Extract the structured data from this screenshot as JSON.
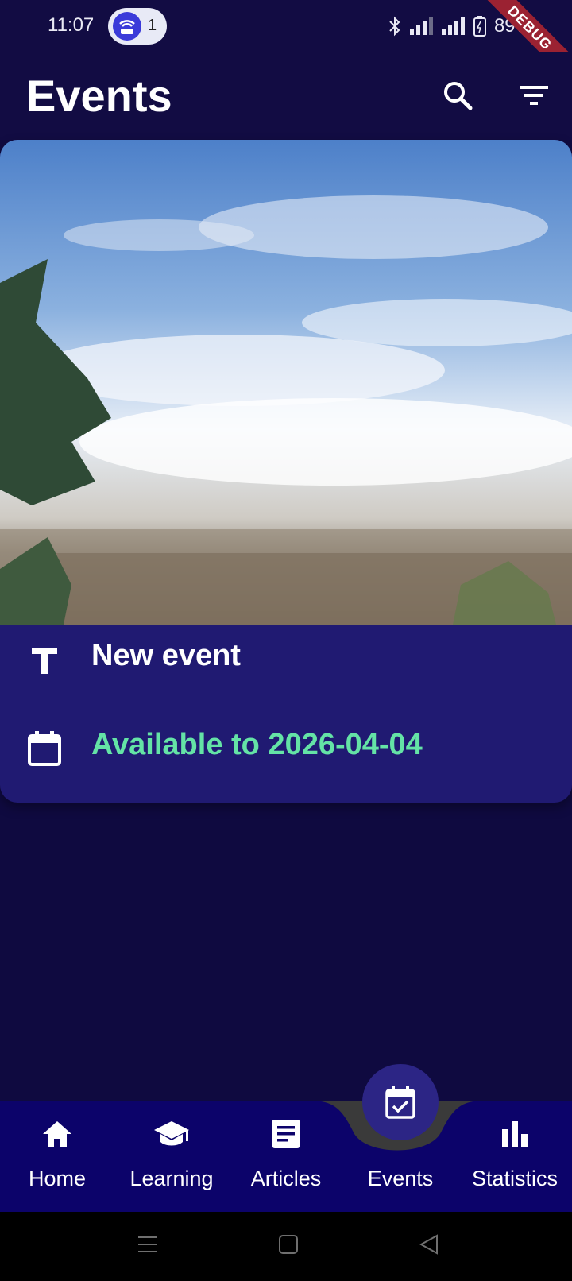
{
  "status_bar": {
    "time": "11:07",
    "notification_count": "1",
    "battery": "89%",
    "debug_label": "DEBUG"
  },
  "app_bar": {
    "title": "Events",
    "search_icon": "search-icon",
    "filter_icon": "filter-icon"
  },
  "event_card": {
    "title_icon": "text-title-icon",
    "title": "New event",
    "date_icon": "calendar-icon",
    "availability": "Available to 2026-04-04"
  },
  "bottom_nav": {
    "items": [
      {
        "label": "Home",
        "icon": "home-icon"
      },
      {
        "label": "Learning",
        "icon": "graduation-cap-icon"
      },
      {
        "label": "Articles",
        "icon": "article-icon"
      },
      {
        "label": "Events",
        "icon": "event-available-icon",
        "selected": true
      },
      {
        "label": "Statistics",
        "icon": "bar-chart-icon"
      }
    ]
  },
  "colors": {
    "background": "#0f0a40",
    "card": "#201a72",
    "accent_green": "#64e3a6",
    "nav_bar": "#0c036a"
  }
}
